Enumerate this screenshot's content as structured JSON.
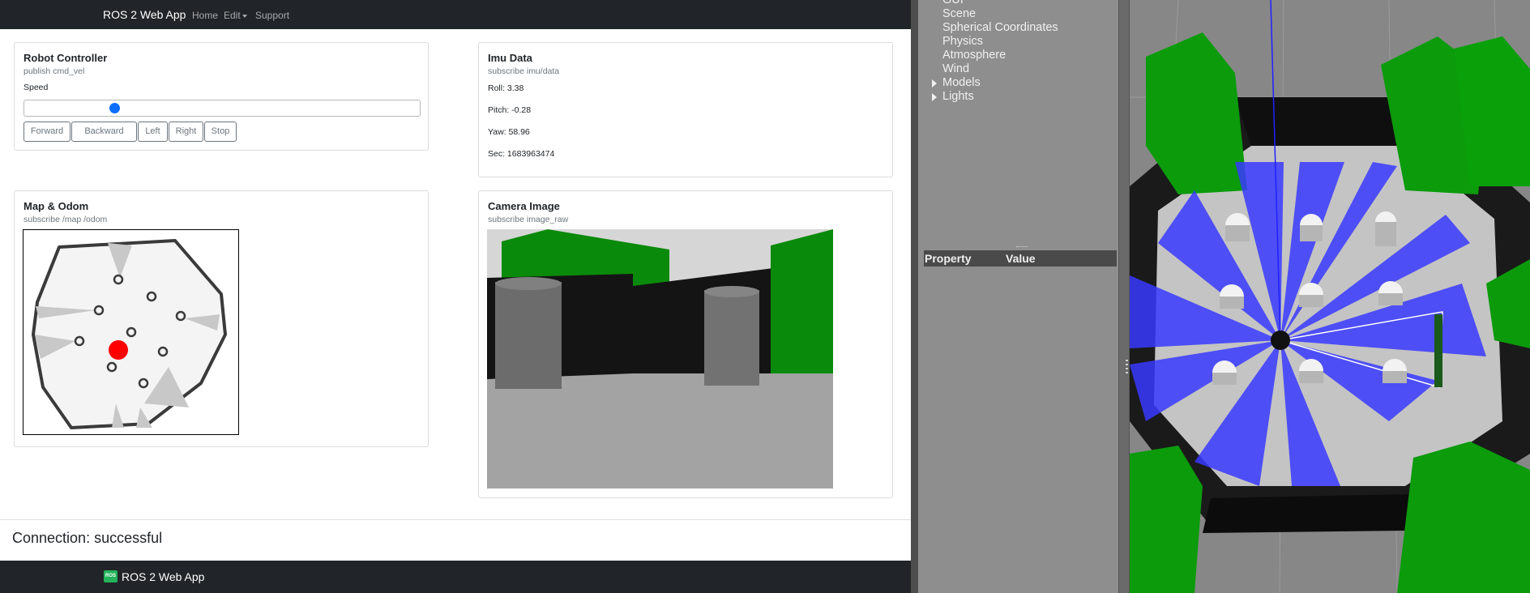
{
  "navbar": {
    "brand": "ROS 2 Web App",
    "links": [
      "Home",
      "Edit",
      "Support"
    ]
  },
  "robot_controller": {
    "title": "Robot Controller",
    "subtitle": "publish cmd_vel",
    "speed_label": "Speed",
    "speed_value": 0.22,
    "buttons": [
      "Forward",
      "Backward",
      "Left",
      "Right",
      "Stop"
    ]
  },
  "imu": {
    "title": "Imu Data",
    "subtitle": "subscribe imu/data",
    "roll": "Roll: 3.38",
    "pitch": "Pitch: -0.28",
    "yaw": "Yaw: 58.96",
    "sec": "Sec: 1683963474"
  },
  "map": {
    "title": "Map & Odom",
    "subtitle": "subscribe /map /odom"
  },
  "camera": {
    "title": "Camera Image",
    "subtitle": "subscribe image_raw"
  },
  "connection": "Connection: successful",
  "footer": {
    "logo_text": "ROS",
    "brand": "ROS 2 Web App"
  },
  "gazebo": {
    "tree_items": [
      "GUI",
      "Scene",
      "Spherical Coordinates",
      "Physics",
      "Atmosphere",
      "Wind",
      "Models",
      "Lights"
    ],
    "property_columns": [
      "Property",
      "Value"
    ]
  },
  "colors": {
    "navbar": "#212529",
    "primary": "#0d6efd",
    "secondary": "#6c757d",
    "robot_marker": "#ff0000",
    "laser": "#3a3aff",
    "gazebo_panel": "#8e8e8e"
  }
}
